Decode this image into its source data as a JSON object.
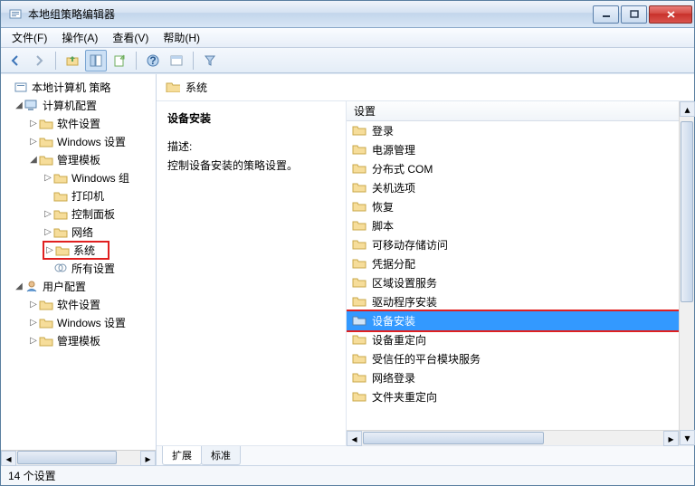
{
  "window": {
    "title": "本地组策略编辑器"
  },
  "menu": {
    "file": "文件(F)",
    "action": "操作(A)",
    "view": "查看(V)",
    "help": "帮助(H)"
  },
  "tree": {
    "root": "本地计算机 策略",
    "computer_config": "计算机配置",
    "software_settings": "软件设置",
    "windows_settings": "Windows 设置",
    "admin_templates": "管理模板",
    "windows_components": "Windows 组",
    "printers": "打印机",
    "control_panel": "控制面板",
    "network": "网络",
    "system": "系统",
    "all_settings": "所有设置",
    "user_config": "用户配置",
    "u_software_settings": "软件设置",
    "u_windows_settings": "Windows 设置",
    "u_admin_templates": "管理模板"
  },
  "content": {
    "header": "系统",
    "desc_title": "设备安装",
    "desc_label": "描述:",
    "desc_text": "控制设备安装的策略设置。",
    "column": "设置"
  },
  "list": [
    "登录",
    "电源管理",
    "分布式 COM",
    "关机选项",
    "恢复",
    "脚本",
    "可移动存储访问",
    "凭据分配",
    "区域设置服务",
    "驱动程序安装",
    "设备安装",
    "设备重定向",
    "受信任的平台模块服务",
    "网络登录",
    "文件夹重定向"
  ],
  "selected_index": 10,
  "tabs": {
    "extended": "扩展",
    "standard": "标准"
  },
  "status": "14 个设置"
}
